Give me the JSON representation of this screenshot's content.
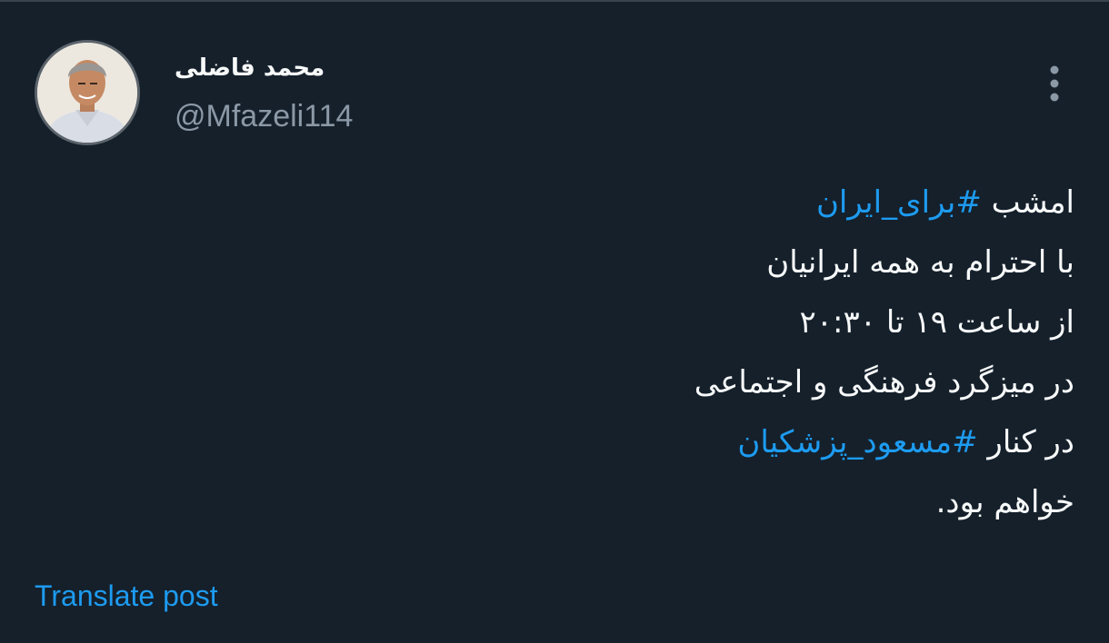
{
  "author": {
    "display_name": "محمد فاضلی",
    "handle": "@Mfazeli114",
    "avatar_icon": "profile-photo"
  },
  "menu": {
    "icon": "more-vertical-icon"
  },
  "tweet": {
    "line1": {
      "text": "امشب ",
      "hashtag": "#برای_ایران"
    },
    "line2": "با احترام به همه ایرانیان",
    "line3": "از ساعت ۱۹ تا ۲۰:۳۰",
    "line4": "در میزگرد فرهنگی و اجتماعی",
    "line5": {
      "text": "در کنار ",
      "hashtag": "#مسعود_پزشکیان"
    },
    "line6": "خواهم بود."
  },
  "actions": {
    "translate_label": "Translate post"
  },
  "colors": {
    "background": "#15202b",
    "text": "#f7f9f9",
    "muted": "#8b98a5",
    "accent": "#1d9bf0"
  }
}
